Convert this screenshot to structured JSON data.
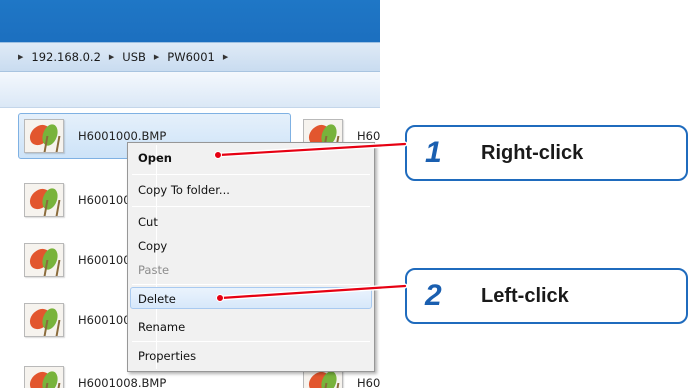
{
  "address_bar": {
    "crumbs": [
      "192.168.0.2",
      "USB",
      "PW6001"
    ]
  },
  "files": {
    "col1": [
      "H6001000.BMP",
      "H600100",
      "H600100",
      "H600100",
      "H6001008.BMP"
    ],
    "col2": [
      "H60",
      "H60"
    ]
  },
  "context_menu": {
    "open": "Open",
    "copy_to_folder": "Copy To folder...",
    "cut": "Cut",
    "copy": "Copy",
    "paste": "Paste",
    "delete": "Delete",
    "rename": "Rename",
    "properties": "Properties"
  },
  "callouts": [
    {
      "number": "1",
      "text": "Right-click"
    },
    {
      "number": "2",
      "text": "Left-click"
    }
  ],
  "colors": {
    "accent": "#1f6bbd",
    "titlebar": "#1f77c6",
    "leader_red": "#e60012"
  }
}
